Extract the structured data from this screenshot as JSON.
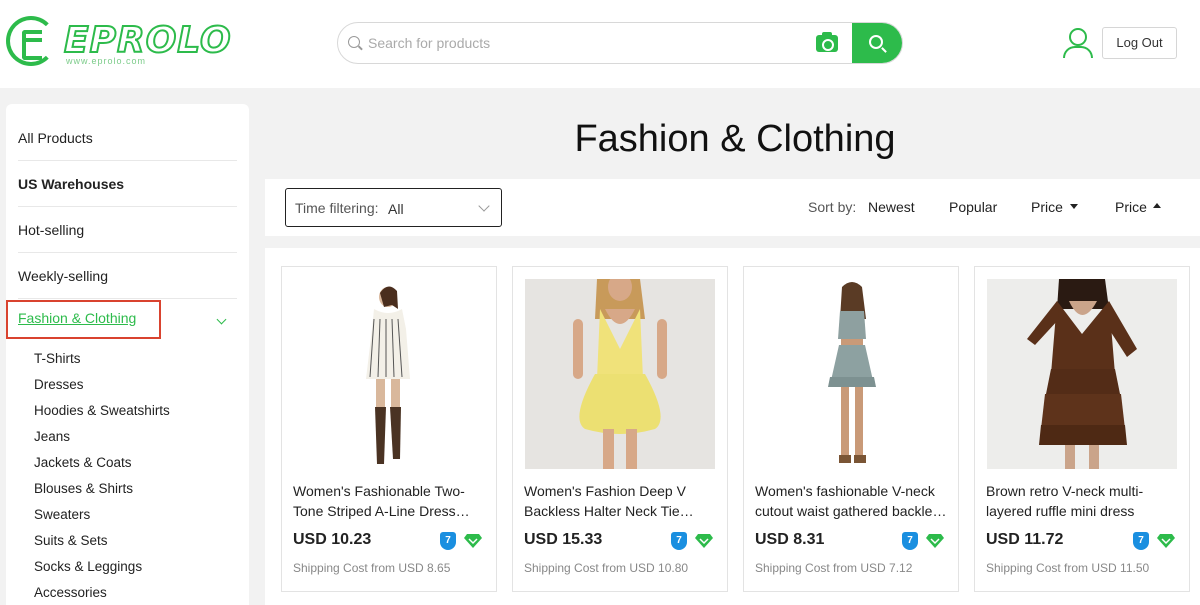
{
  "brand": {
    "name": "EPROLO",
    "url": "www.eprolo.com",
    "accent": "#2dbb4b"
  },
  "search": {
    "placeholder": "Search for products",
    "value": ""
  },
  "header": {
    "logout_label": "Log Out"
  },
  "sidebar": {
    "categories": [
      {
        "label": "All Products"
      },
      {
        "label": "US Warehouses"
      },
      {
        "label": "Hot-selling"
      },
      {
        "label": "Weekly-selling"
      },
      {
        "label": "Fashion & Clothing"
      }
    ],
    "subcategories": [
      "T-Shirts",
      "Dresses",
      "Hoodies & Sweatshirts",
      "Jeans",
      "Jackets & Coats",
      "Blouses & Shirts",
      "Sweaters",
      "Suits & Sets",
      "Socks & Leggings",
      "Accessories"
    ]
  },
  "main": {
    "title": "Fashion & Clothing",
    "filter": {
      "label": "Time filtering:",
      "value": "All"
    },
    "sort": {
      "label": "Sort by:",
      "options": [
        "Newest",
        "Popular",
        "Price",
        "Price"
      ]
    }
  },
  "products": [
    {
      "name": "Women's Fashionable Two-Tone Striped A-Line Dress With Ruffled Collar",
      "price": "USD 10.23",
      "shipping": "Shipping Cost from USD 8.65",
      "badge": "7"
    },
    {
      "name": "Women's Fashion Deep V Backless Halter Neck Tie Bubble Dress",
      "price": "USD 15.33",
      "shipping": "Shipping Cost from USD 10.80",
      "badge": "7"
    },
    {
      "name": "Women's fashionable V-neck cutout waist gathered backless mini dress",
      "price": "USD 8.31",
      "shipping": "Shipping Cost from USD 7.12",
      "badge": "7"
    },
    {
      "name": "Brown retro V-neck multi-layered ruffle mini dress",
      "price": "USD 11.72",
      "shipping": "Shipping Cost from USD 11.50",
      "badge": "7"
    }
  ]
}
